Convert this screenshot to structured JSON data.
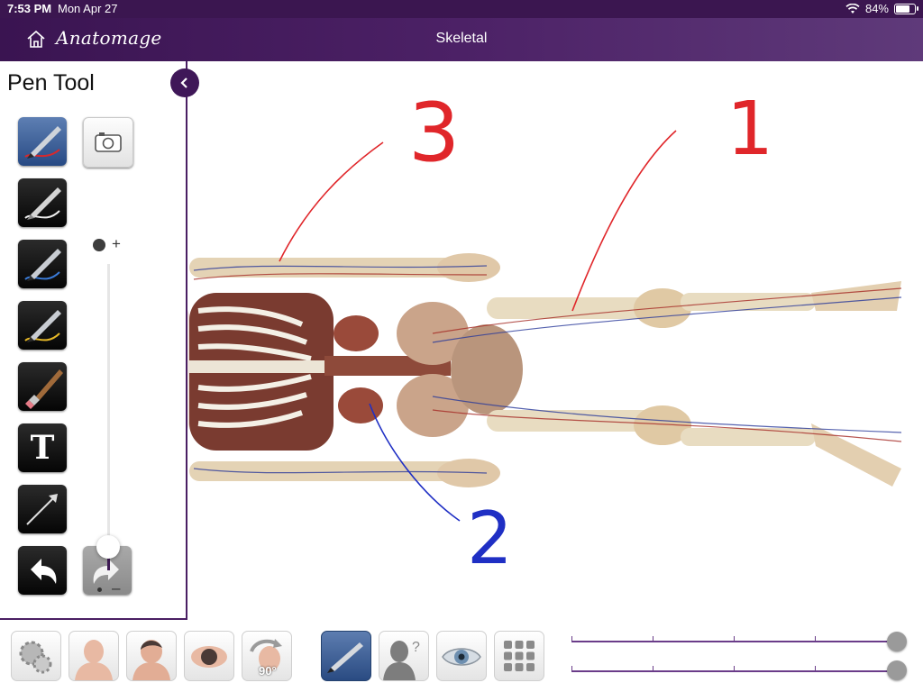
{
  "status_bar": {
    "time": "7:53 PM",
    "date": "Mon Apr 27",
    "battery": "84%",
    "battery_level": 0.84
  },
  "nav": {
    "logo": "Anatomage",
    "title": "Skeletal"
  },
  "panel": {
    "title": "Pen Tool",
    "text_tool_glyph": "T"
  },
  "annotations": {
    "label_1": "1",
    "label_2": "2",
    "label_3": "3"
  },
  "colors": {
    "accent": "#4a1f63",
    "pen_red": "#e0262a",
    "pen_blue": "#1f2fc4"
  },
  "bottom_toolbar": {
    "rotate_badge": "90°"
  },
  "sliders": {
    "pen_size": 0.07,
    "slider_top": 1.0,
    "slider_bottom": 1.0
  }
}
